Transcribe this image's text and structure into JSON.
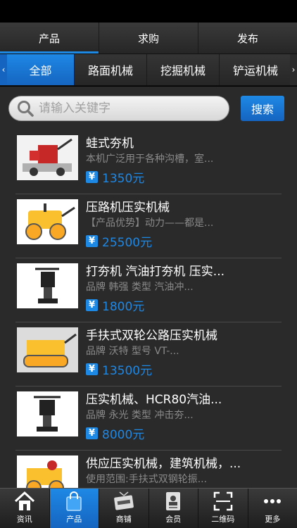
{
  "tabs": [
    "产品",
    "求购",
    "发布"
  ],
  "categories": {
    "left_arrow": "‹",
    "right_arrow": "›",
    "items": [
      "全部",
      "路面机械",
      "挖掘机械",
      "铲运机械"
    ]
  },
  "search": {
    "placeholder": "请输入关键字",
    "button": "搜索"
  },
  "products": [
    {
      "title": "蛙式夯机",
      "desc": "本机广泛用于各种沟槽，室...",
      "price": "1350元"
    },
    {
      "title": "压路机压实机械",
      "desc": "【产品优势】动力——都是...",
      "price": "25500元"
    },
    {
      "title": "打夯机 汽油打夯机 压实...",
      "desc": "品牌 韩强 类型 汽油冲...",
      "price": "1800元"
    },
    {
      "title": "手扶式双轮公路压实机械",
      "desc": "品牌 沃特 型号 VT-...",
      "price": "13500元"
    },
    {
      "title": "压实机械、HCR80汽油...",
      "desc": "品牌 永光 类型 冲击夯...",
      "price": "8000元"
    },
    {
      "title": "供应压实机械，建筑机械，...",
      "desc": "使用范围:手扶式双钢轮振...",
      "price": ""
    }
  ],
  "yen_symbol": "¥",
  "bottom_nav": [
    "资讯",
    "产品",
    "商铺",
    "会员",
    "二维码",
    "更多"
  ],
  "colors": {
    "accent": "#1e88e5",
    "background": "#2a2a2a"
  }
}
